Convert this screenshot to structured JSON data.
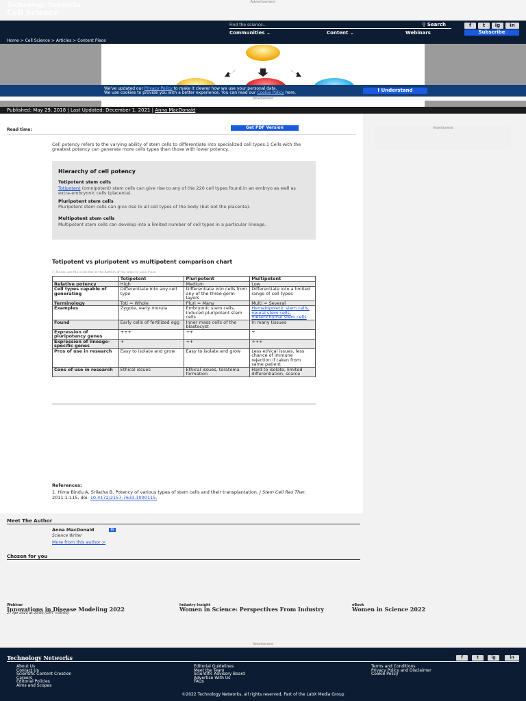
{
  "ads": {
    "label": "Advertisement"
  },
  "header": {
    "brand_top": "Technology Networks",
    "brand_bottom": "Cell Science",
    "search_placeholder": "Find the science...",
    "search_button": "Search",
    "nav": [
      "Communities",
      "Content",
      "Webinars"
    ],
    "social": [
      "f",
      "t",
      "ig",
      "in"
    ],
    "subscribe": "Subscribe"
  },
  "breadcrumb": [
    "Home",
    "Cell Science",
    "Articles",
    "Content Piece"
  ],
  "cookie": {
    "line1_pre": "We've updated our ",
    "line1_link": "Privacy Policy",
    "line1_post": " to make it clearer how we use your personal data.",
    "line2_pre": "We use cookies to provide you with a better experience. You can read our ",
    "line2_link": "Cookie Policy",
    "line2_post": " here.",
    "button": "I Understand"
  },
  "article": {
    "published": "Published: May 29, 2018 | Last Updated: December 1, 2021 |",
    "author_link": "Anna MacDonald",
    "read_time": "Read time:",
    "pdf_button": "Get PDF Version",
    "intro": "Cell potency refers to the varying ability of stem cells to differentiate into specialized cell types.1 Cells with the greatest potency can generate more cells types than those with lower potency.",
    "hierarchy": {
      "title": "Hierarchy of cell potency",
      "toti_h": "Totipotent stem cells",
      "toti_link": "Totipotent",
      "toti_text": " (omnipotent) stem cells can give rise to any of the 220 cell types found in an embryo as well as extra-embryonic cells (placenta).",
      "pluri_h": "Pluripotent stem cells",
      "pluri_text": "Pluripotent stem cells can give rise to all cell types of the body (but not the placenta).",
      "multi_h": "Multipotent stem cells",
      "multi_text": "Multipotent stem cells can develop into a limited number of cell types in a particular lineage."
    },
    "comparison_title": "Totipotent vs pluripotent vs multipotent comparison chart",
    "scroll_note": "☐ Please use the scroll bar at the bottom of the table to view more.",
    "table": {
      "headers": [
        "",
        "Totipotent",
        "Pluripotent",
        "Multipotent"
      ],
      "rows": [
        [
          "Relative potency",
          "High",
          "Medium",
          "Low"
        ],
        [
          "Cell types capable of generating",
          "Differentiate into any cell type",
          "Differentiate into cells from any of the three germ layers",
          "Differentiate into a limited range of cell types"
        ],
        [
          "Terminology",
          "Toti = Whole",
          "Pluri = Many",
          "Multi = Several"
        ],
        [
          "Examples",
          "Zygote, early morula",
          "Embryonic stem cells, Induced pluripotent stem cells",
          "Hematopoietic stem cells, neural stem cells, mesenchymal stem cells"
        ],
        [
          "Found",
          "Early cells of fertilized egg",
          "Inner mass cells of the blastocyst",
          "In many tissues"
        ],
        [
          "Expression of pluripotency genes",
          "+++",
          "++",
          "+"
        ],
        [
          "Expression of lineage-specific genes",
          "+",
          "++",
          "+++"
        ],
        [
          "Pros of use in research",
          "Easy to isolate and grow",
          "Easy to isolate and grow",
          "Less ethical issues, less chance of immune rejection if taken from same patient"
        ],
        [
          "Cons of use in research",
          "Ethical issues",
          "Ethical issues, teratoma formation",
          "Hard to isolate, limited differentiation, scarce"
        ]
      ]
    },
    "references_h": "References:",
    "reference_text": "1. Hima Bindu A, Srilatha B. Potency of various types of stem cells and their transplantation. ",
    "reference_journal": "J Stem Cell Res Ther.",
    "reference_tail": " 2011;1:115. doi: ",
    "reference_doi": "10.4172/2157-7633.1000115."
  },
  "author": {
    "heading": "Meet The Author",
    "name": "Anna MacDonald",
    "badge": "in",
    "role": "Science Writer",
    "more": "More from this author >"
  },
  "chosen": {
    "heading": "Chosen for you",
    "cards": [
      {
        "type": "Webinar",
        "title": "Innovations in Disease Modeling 2022",
        "date": "27 Apr 2022 at 20:00 (GMT +05:00)"
      },
      {
        "type": "Industry Insight",
        "title": "Women in Science: Perspectives From Industry",
        "date": ""
      },
      {
        "type": "eBook",
        "title": "Women in Science 2022",
        "date": ""
      }
    ]
  },
  "footer": {
    "brand": "Technology Networks",
    "col1": [
      "About Us",
      "Contact Us",
      "Scientific Content Creation",
      "Careers",
      "Editorial Policies",
      "Aims and Scopes"
    ],
    "col2": [
      "Editorial Guidelines",
      "Meet the Team",
      "Scientific Advisory Board",
      "Advertise With Us",
      "FAQs"
    ],
    "col3": [
      "Terms and Conditions",
      "Privacy Policy and Disclaimer",
      "Cookie Policy"
    ],
    "copyright": "©2022 Technology Networks, all rights reserved, Part of the LabX Media Group"
  }
}
